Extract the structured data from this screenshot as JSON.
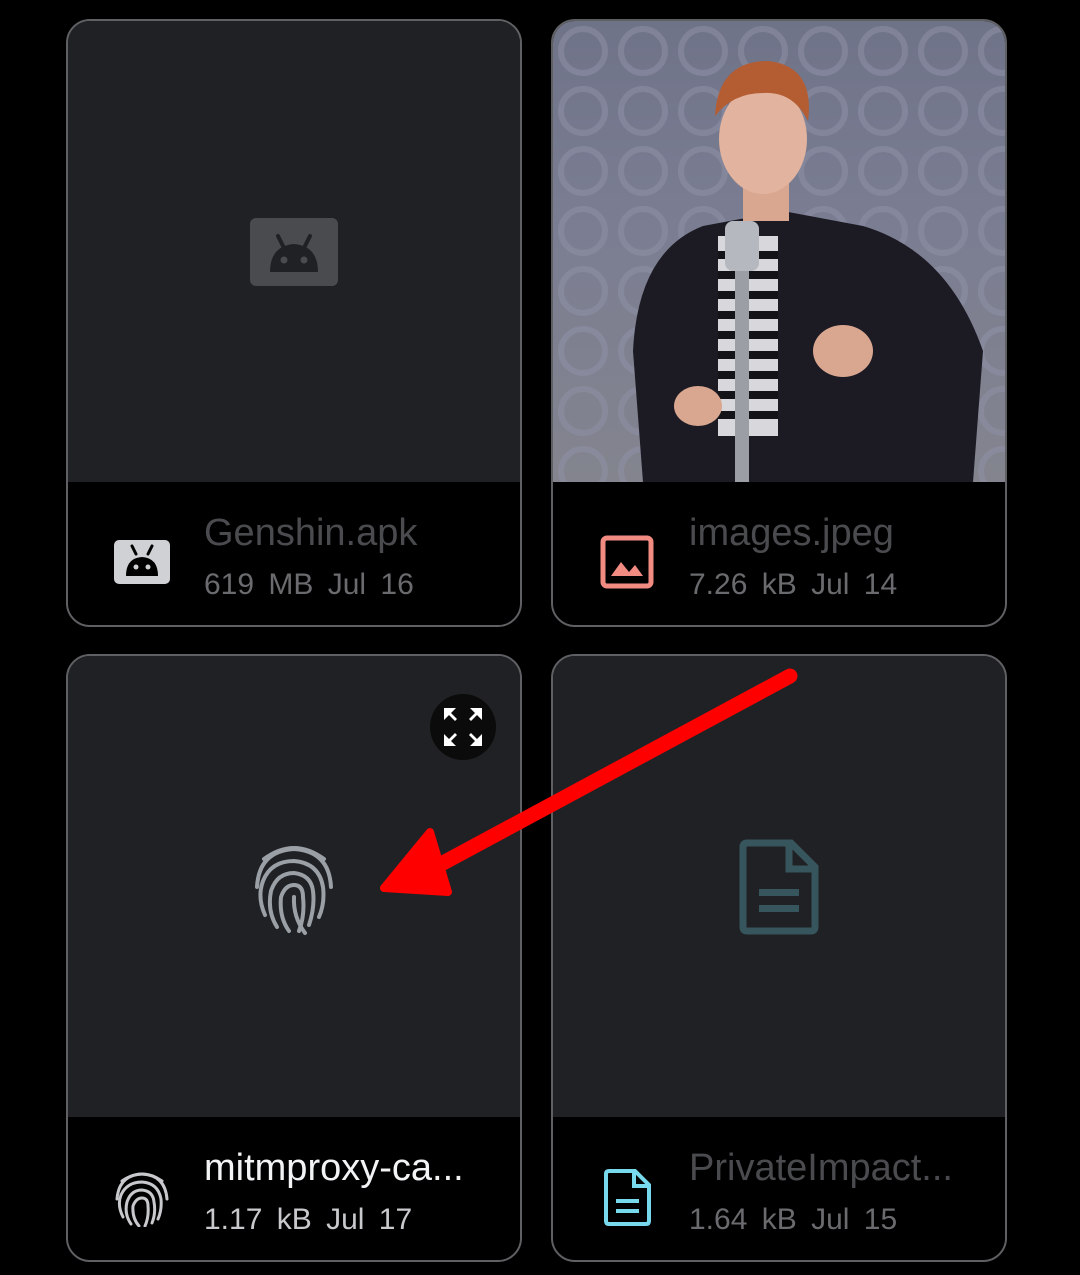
{
  "files": [
    {
      "name": "Genshin.apk",
      "size": "619 MB",
      "date": "Jul 16",
      "type_icon": "android-icon"
    },
    {
      "name": "images.jpeg",
      "size": "7.26 kB",
      "date": "Jul 14",
      "type_icon": "image-icon"
    },
    {
      "name": "mitmproxy-ca...",
      "size": "1.17 kB",
      "date": "Jul 17",
      "type_icon": "fingerprint-icon"
    },
    {
      "name": "PrivateImpact...",
      "size": "1.64 kB",
      "date": "Jul 15",
      "type_icon": "document-icon"
    }
  ],
  "colors": {
    "background": "#000000",
    "card_thumb": "#202124",
    "card_border": "#5f6063",
    "android_icon": "#cfd1d4",
    "image_icon": "#f28b82",
    "document_icon": "#78d9ec",
    "annotation_arrow": "#ff0000"
  }
}
